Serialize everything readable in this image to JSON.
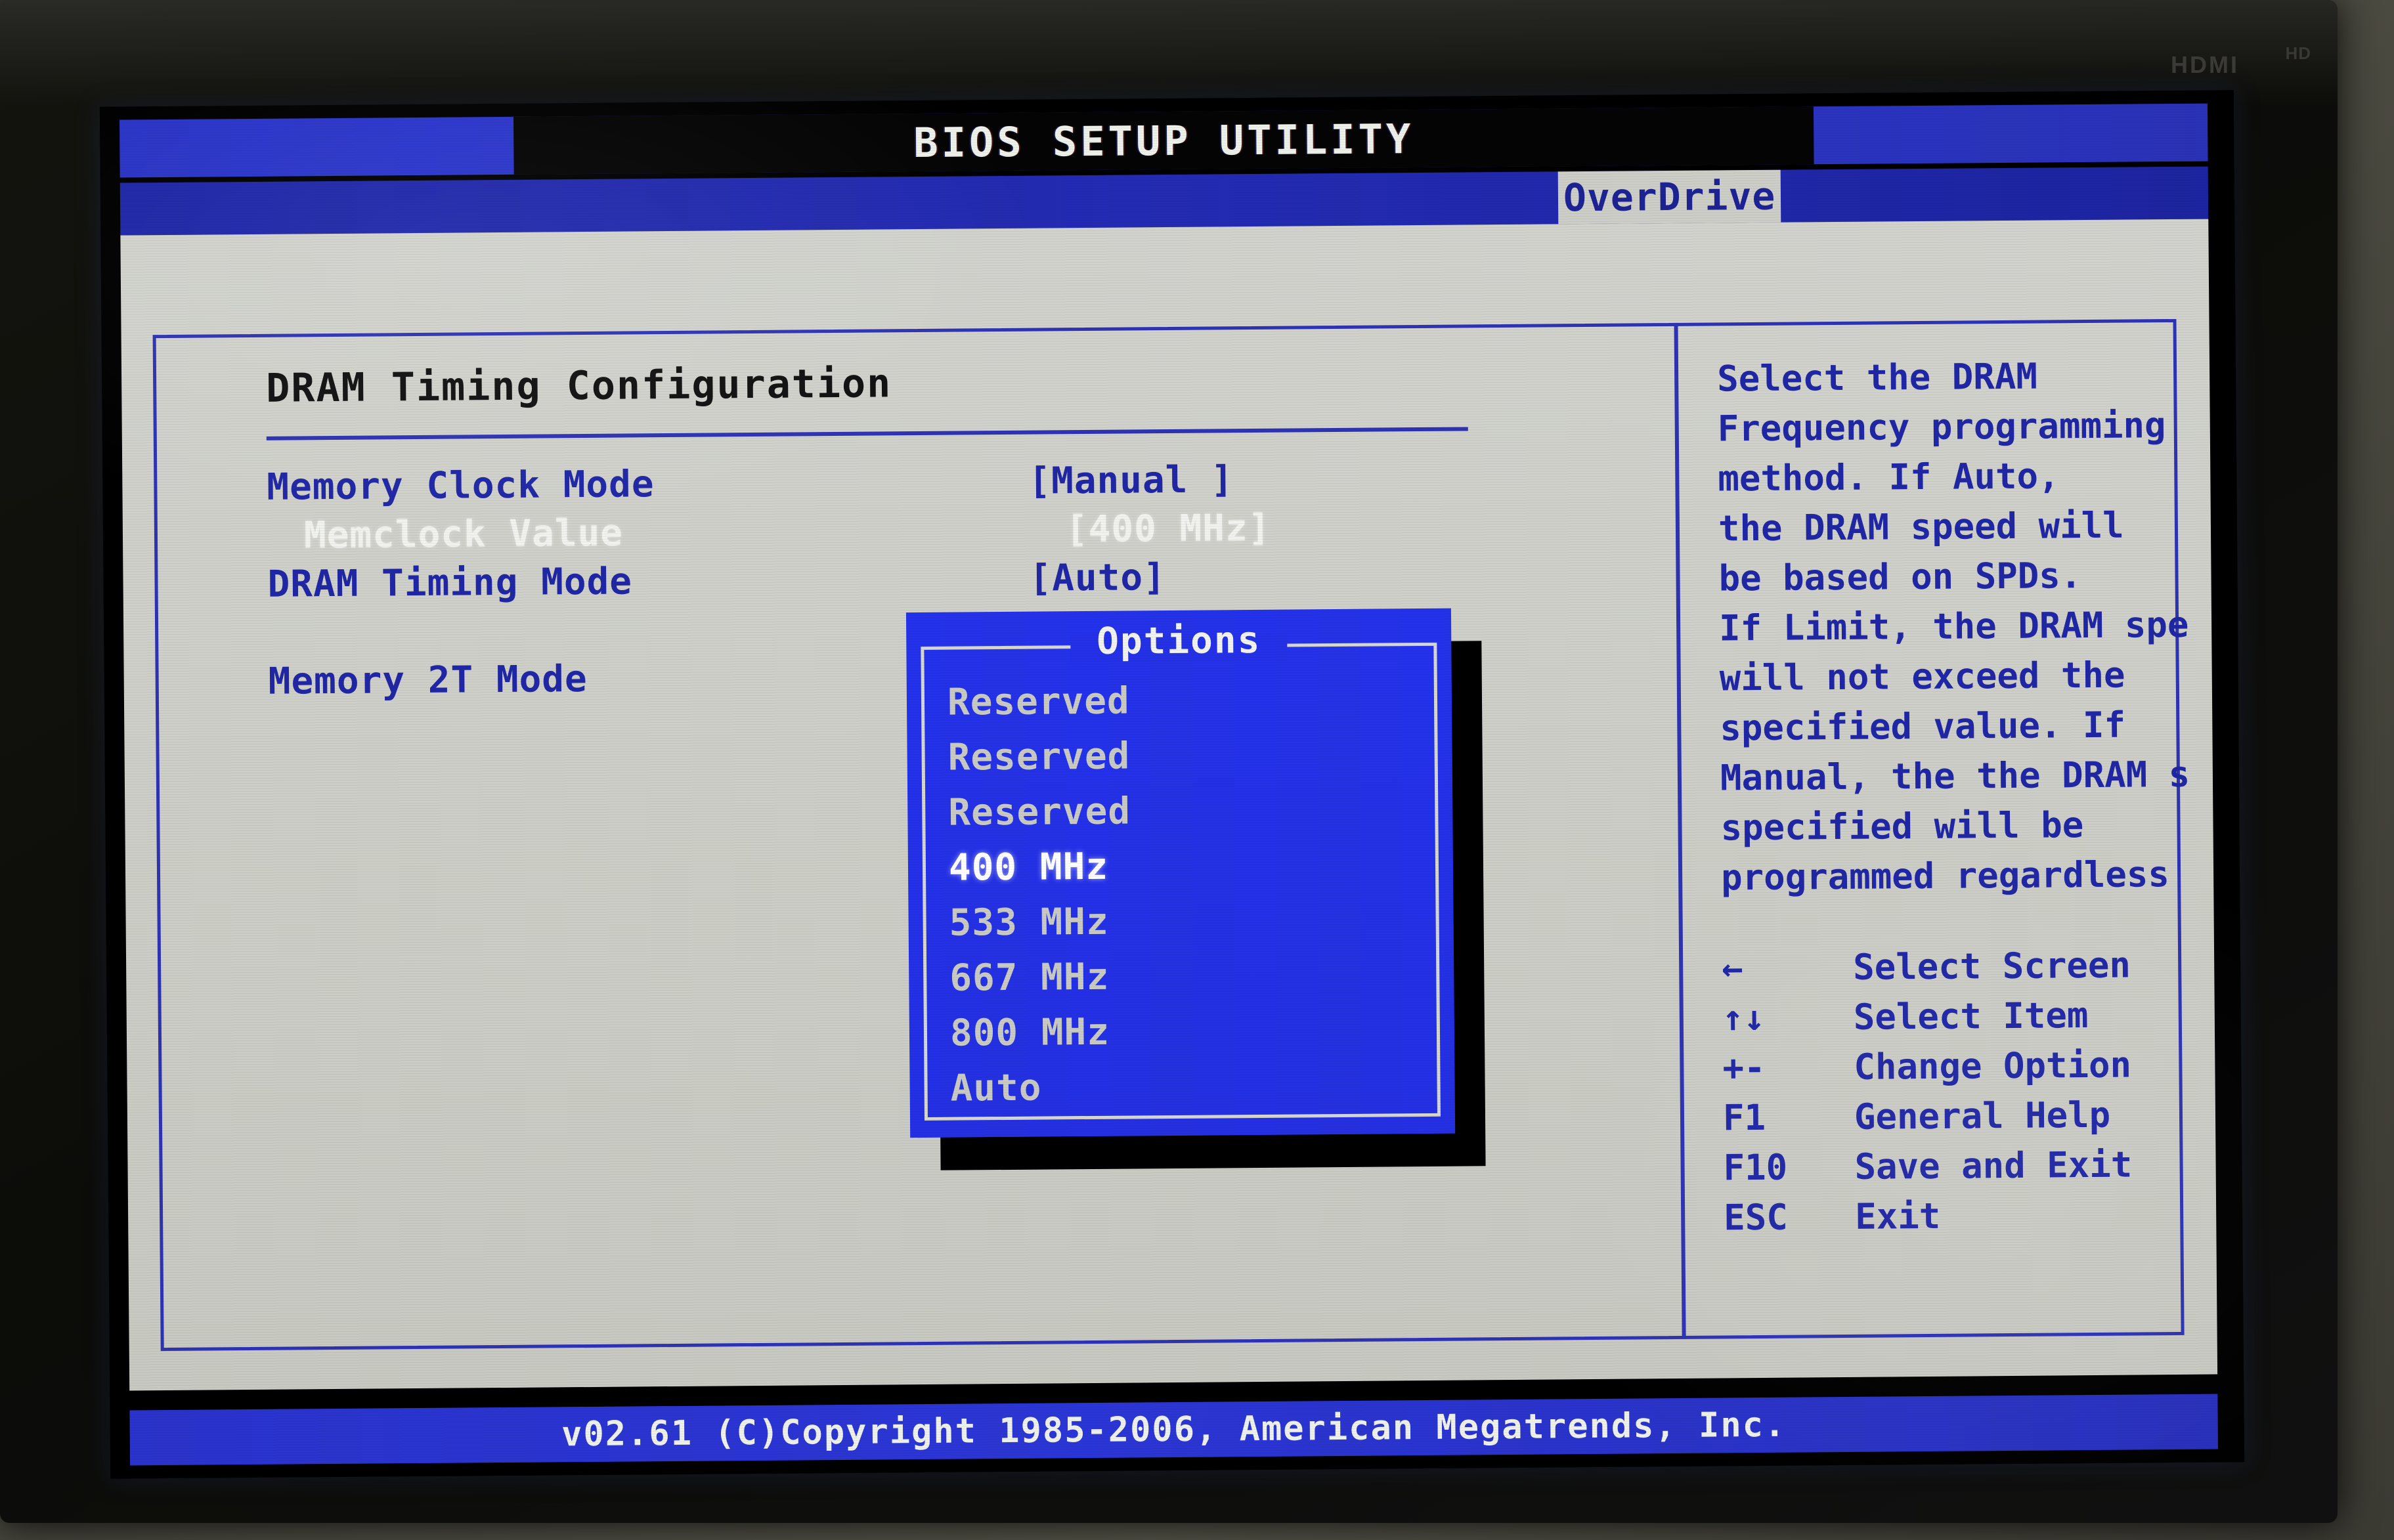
{
  "device": {
    "bezel_logo": "HDMI",
    "bezel_badge": "HD"
  },
  "header": {
    "title": "BIOS SETUP UTILITY"
  },
  "menubar": {
    "active_tab": "OverDrive"
  },
  "settings_panel": {
    "section_title": "DRAM Timing Configuration",
    "rows": [
      {
        "label": "Memory Clock Mode",
        "value": "[Manual ]",
        "selected": false,
        "indent": false
      },
      {
        "label": "Memclock Value",
        "value": "[400 MHz]",
        "selected": true,
        "indent": true
      },
      {
        "label": "DRAM Timing Mode",
        "value": "[Auto]",
        "selected": false,
        "indent": false
      },
      {
        "label": "",
        "value": "",
        "selected": false,
        "indent": false
      },
      {
        "label": "Memory 2T Mode",
        "value": "",
        "selected": false,
        "indent": false
      }
    ]
  },
  "options_dialog": {
    "title": "Options",
    "items": [
      {
        "label": "Reserved",
        "current": false
      },
      {
        "label": "Reserved",
        "current": false
      },
      {
        "label": "Reserved",
        "current": false
      },
      {
        "label": "400 MHz",
        "current": true
      },
      {
        "label": "533 MHz",
        "current": false
      },
      {
        "label": "667 MHz",
        "current": false
      },
      {
        "label": "800 MHz",
        "current": false
      },
      {
        "label": "Auto",
        "current": false
      }
    ]
  },
  "help_panel": {
    "lines": [
      "Select the DRAM",
      "Frequency programming",
      "method. If Auto,",
      "the DRAM speed will",
      "be based on SPDs.",
      "If Limit, the DRAM spe",
      "will not exceed the",
      "specified value. If",
      "Manual, the the DRAM s",
      "specified will be",
      "programmed regardless"
    ],
    "keys": [
      {
        "key": "←",
        "desc": "Select Screen"
      },
      {
        "key": "↑↓",
        "desc": "Select Item"
      },
      {
        "key": "+-",
        "desc": "Change Option"
      },
      {
        "key": "F1",
        "desc": "General Help"
      },
      {
        "key": "F10",
        "desc": "Save and Exit"
      },
      {
        "key": "ESC",
        "desc": "Exit"
      }
    ]
  },
  "footer": {
    "copyright": "v02.61 (C)Copyright 1985-2006, American Megatrends, Inc."
  },
  "colors": {
    "accent_blue": "#2027a5",
    "bar_blue": "#2a33cc",
    "panel_gray": "#cdcec7",
    "dialog_blue": "#2431e6",
    "highlight_white": "#ffffff"
  }
}
